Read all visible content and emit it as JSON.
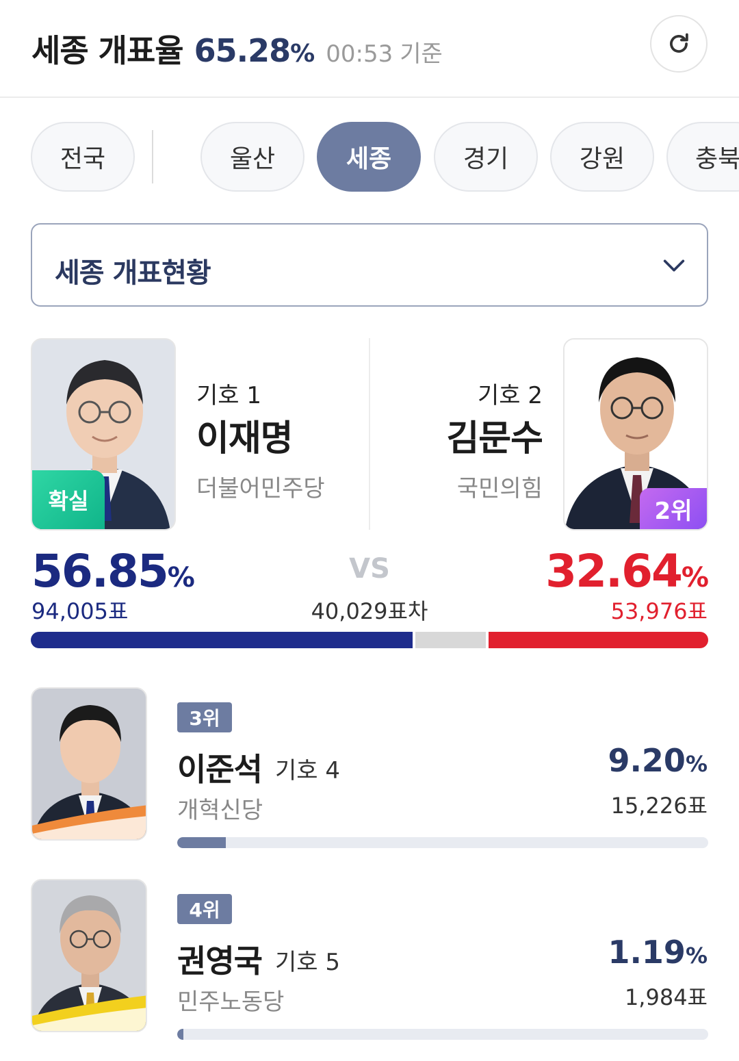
{
  "header": {
    "region_label": "세종 개표율",
    "counting_rate": "65.28",
    "percent_sign": "%",
    "time": "00:53",
    "basis": "기준",
    "refresh_icon": "refresh-icon"
  },
  "tabs": [
    {
      "label": "전국",
      "active": false
    },
    {
      "label": "울산",
      "active": false
    },
    {
      "label": "세종",
      "active": true
    },
    {
      "label": "경기",
      "active": false
    },
    {
      "label": "강원",
      "active": false
    },
    {
      "label": "충북",
      "active": false
    }
  ],
  "dropdown": {
    "label": "세종 개표현황",
    "icon": "chevron-down-icon"
  },
  "leaders": {
    "left": {
      "number_label": "기호 1",
      "name": "이재명",
      "party": "더불어민주당",
      "badge": "확실",
      "percent": "56.85",
      "percent_sign": "%",
      "votes": "94,005표",
      "color": "#1b2a80"
    },
    "right": {
      "number_label": "기호 2",
      "name": "김문수",
      "party": "국민의힘",
      "badge": "2위",
      "percent": "32.64",
      "percent_sign": "%",
      "votes": "53,976표",
      "color": "#e1202e"
    },
    "vs": "VS",
    "difference": "40,029표차",
    "bar_shares": {
      "left": 56.85,
      "right": 32.64
    }
  },
  "others": [
    {
      "rank": "3위",
      "name": "이준석",
      "number_label": "기호 4",
      "party": "개혁신당",
      "percent": "9.20",
      "percent_sign": "%",
      "votes": "15,226표",
      "share": 9.2
    },
    {
      "rank": "4위",
      "name": "권영국",
      "number_label": "기호 5",
      "party": "민주노동당",
      "percent": "1.19",
      "percent_sign": "%",
      "votes": "1,984표",
      "share": 1.19
    }
  ],
  "colors": {
    "accent": "#6d7ca1",
    "left_party": "#1b2a80",
    "right_party": "#e1202e",
    "sure_badge": "#10b58a",
    "rank2_badge": "#8d4ff2"
  }
}
